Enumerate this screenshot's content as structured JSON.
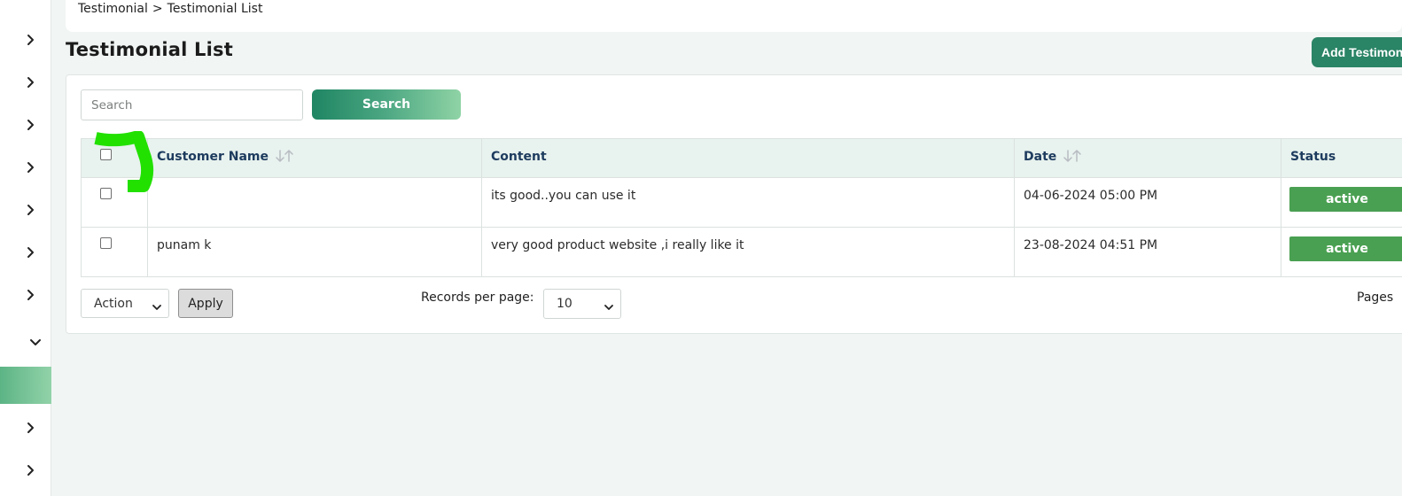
{
  "breadcrumb": {
    "parent": "Testimonial",
    "separator": ">",
    "current": "Testimonial List"
  },
  "page": {
    "title": "Testimonial List",
    "add_button_label": "Add Testimonial"
  },
  "sidebar": {
    "items": [
      {
        "icon": "chevron-right-icon"
      },
      {
        "icon": "chevron-right-icon"
      },
      {
        "icon": "chevron-right-icon"
      },
      {
        "icon": "chevron-right-icon"
      },
      {
        "icon": "chevron-right-icon"
      },
      {
        "icon": "chevron-right-icon"
      },
      {
        "icon": "chevron-right-icon"
      },
      {
        "icon": "chevron-down-icon"
      },
      {
        "icon": "",
        "active": true
      },
      {
        "icon": "chevron-right-icon"
      },
      {
        "icon": "chevron-right-icon"
      }
    ]
  },
  "search": {
    "placeholder": "Search",
    "value": "",
    "button_label": "Search"
  },
  "table": {
    "columns": [
      {
        "label": "",
        "type": "checkbox"
      },
      {
        "label": "Customer Name",
        "sortable": true
      },
      {
        "label": "Content",
        "sortable": false
      },
      {
        "label": "Date",
        "sortable": true
      },
      {
        "label": "Status",
        "sortable": false
      }
    ],
    "rows": [
      {
        "customer_name": "",
        "content": "its good..you can use it",
        "date": "04-06-2024 05:00 PM",
        "status": "active"
      },
      {
        "customer_name": "punam k",
        "content": "very good product website ,i really like it",
        "date": "23-08-2024 04:51 PM",
        "status": "active"
      }
    ]
  },
  "footer": {
    "action_select": {
      "selected": "Action"
    },
    "apply_label": "Apply",
    "records_per_page_label": "Records per page:",
    "records_per_page": {
      "selected": "10"
    },
    "pages_label": "Pages"
  },
  "colors": {
    "brand_green": "#2a8466",
    "status_active": "#4aa052",
    "header_bg": "#e8f2ee",
    "header_text": "#1d3b5e",
    "annotation": "#22e000"
  }
}
